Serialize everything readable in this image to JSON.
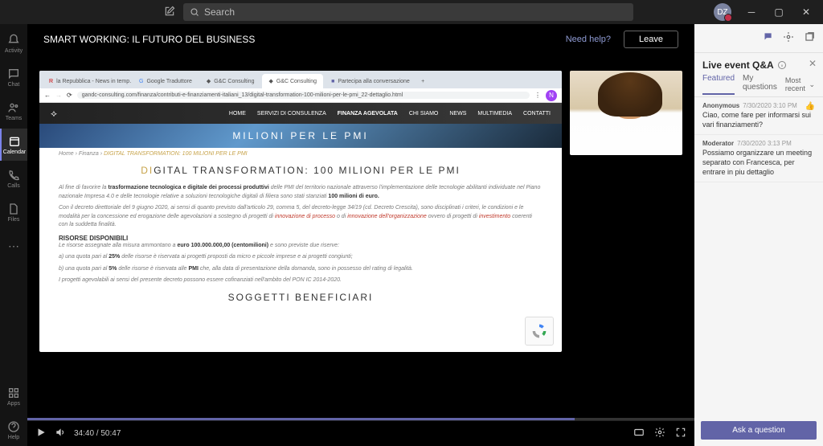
{
  "titlebar": {
    "search_placeholder": "Search",
    "avatar_initials": "DZ"
  },
  "rail": {
    "activity": "Activity",
    "chat": "Chat",
    "teams": "Teams",
    "calendar": "Calendar",
    "calls": "Calls",
    "files": "Files",
    "apps": "Apps",
    "help": "Help"
  },
  "event": {
    "title": "SMART WORKING: IL FUTURO DEL BUSINESS",
    "need_help": "Need help?",
    "leave": "Leave"
  },
  "player": {
    "current": "34:40",
    "duration": "50:47"
  },
  "browser": {
    "tabs": [
      "la Repubblica - News in temp…",
      "Google Traduttore",
      "G&C Consulting",
      "G&C Consulting",
      "Partecipa alla conversazione"
    ],
    "active_tab": 3,
    "url": "gandc-consulting.com/finanza/contributi-e-finanziamenti-italiani_13/digital-transformation-100-milioni-per-le-pmi_22-dettaglio.html",
    "avatar": "N"
  },
  "site": {
    "nav": [
      "HOME",
      "SERVIZI DI CONSULENZA",
      "FINANZA AGEVOLATA",
      "CHI SIAMO",
      "NEWS",
      "MULTIMEDIA",
      "CONTATTI"
    ],
    "hero": "MILIONI PER LE PMI",
    "bc_home": "Home",
    "bc_sec": "Finanza",
    "bc_page": "DIGITAL TRANSFORMATION: 100 MILIONI PER LE PMI",
    "h_pre": "DI",
    "h_main": "GITAL TRANSFORMATION: 100 MILIONI PER LE PMI",
    "p1a": "Al fine di favorire la ",
    "p1b": "trasformazione tecnologica e digitale dei processi produttivi",
    "p1c": " delle PMI del territorio nazionale attraverso l'implementazione delle tecnologie abilitanti individuate nel Piano nazionale Impresa 4.0 e delle tecnologie relative a soluzioni tecnologiche digitali di filiera sono stati stanziati ",
    "p1d": "100 milioni di euro.",
    "p2a": "Con il decreto direttoriale del 9 giugno 2020, ai sensi di quanto previsto dall'articolo 29, comma 5, del decreto-legge 34/19 (cd. Decreto Crescita), sono disciplinati i criteri, le condizioni e le modalità per la concessione ed erogazione delle agevolazioni a sostegno di progetti di ",
    "p2b": "innovazione di processo",
    "p2c": " o di ",
    "p2d": "innovazione dell'organizzazione",
    "p2e": " ovvero di progetti di ",
    "p2f": "investimento",
    "p2g": " coerenti con la suddetta finalità.",
    "h3": "RISORSE DISPONIBILI",
    "p3a": "Le risorse assegnate alla misura ammontano a ",
    "p3b": "euro 100.000.000,00 (centomilioni)",
    "p3c": " e sono previste due riserve:",
    "p3d": "a) una quota pari al ",
    "p3e": "25%",
    "p3f": " delle risorse è riservata ai progetti proposti da micro e piccole imprese e ai progetti congiunti;",
    "p3g": "b) una quota pari al ",
    "p3h": "5%",
    "p3i": " delle risorse è riservata alle ",
    "p3j": "PMI",
    "p3k": " che, alla data di presentazione della domanda, sono in possesso del rating di legalità.",
    "p3l": "I progetti agevolabili ai sensi del presente decreto possono essere cofinanziati nell'ambito del PON IC 2014-2020.",
    "h4": "SOGGETTI BENEFICIARI"
  },
  "qa": {
    "title": "Live event Q&A",
    "tab_featured": "Featured",
    "tab_my": "My questions",
    "sort": "Most recent",
    "ask": "Ask a question",
    "items": [
      {
        "author": "Anonymous",
        "ts": "7/30/2020 3:10 PM",
        "text": "Ciao, come fare per informarsi sui vari finanziamenti?"
      },
      {
        "author": "Moderator",
        "ts": "7/30/2020 3:13 PM",
        "text": "Possiamo organizzare un meeting separato con Francesca, per entrare in piu dettaglio"
      }
    ]
  }
}
